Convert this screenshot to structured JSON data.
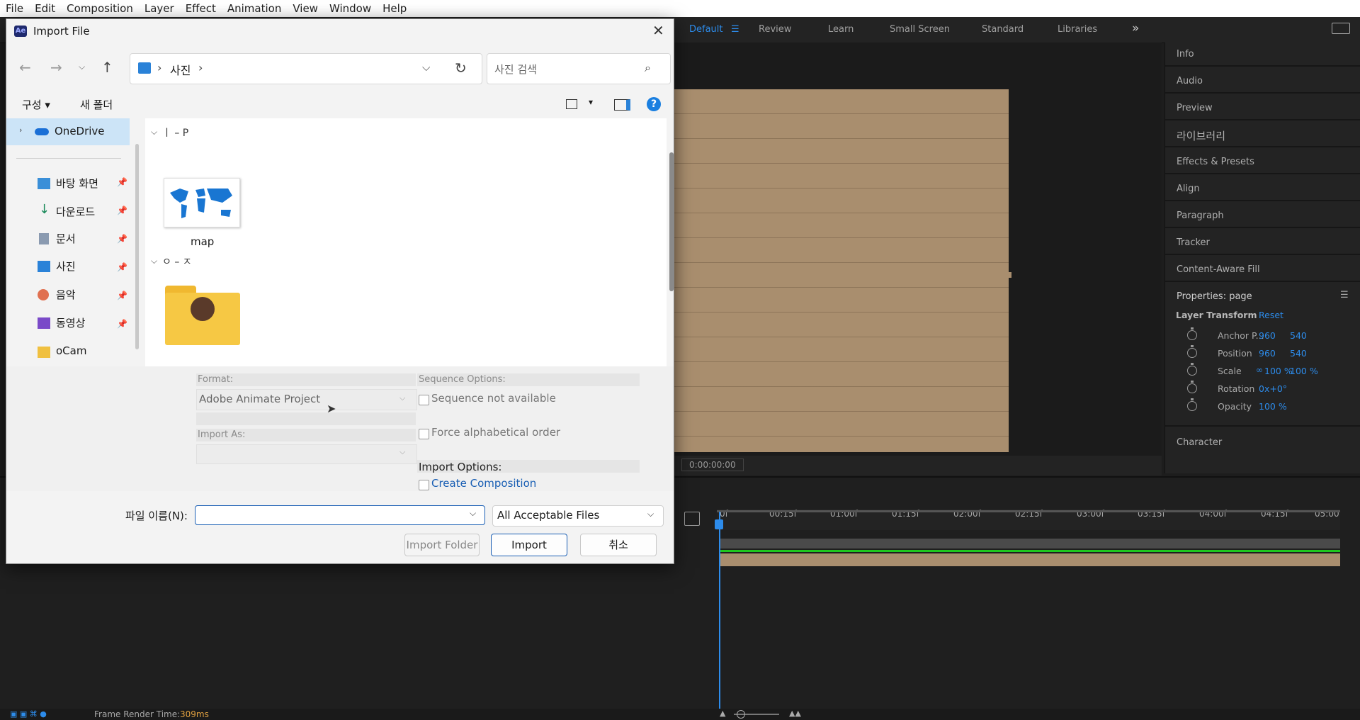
{
  "menubar": [
    "File",
    "Edit",
    "Composition",
    "Layer",
    "Effect",
    "Animation",
    "View",
    "Window",
    "Help"
  ],
  "workspaces": {
    "default": "Default",
    "review": "Review",
    "learn": "Learn",
    "small_screen": "Small Screen",
    "standard": "Standard",
    "libraries": "Libraries",
    "more": "»"
  },
  "right_panel": {
    "items": [
      "Info",
      "Audio",
      "Preview",
      "라이브러리",
      "Effects & Presets",
      "Align",
      "Paragraph",
      "Tracker",
      "Content-Aware Fill"
    ],
    "properties_title": "Properties: page",
    "layer_transform": "Layer Transform",
    "reset": "Reset",
    "props": [
      {
        "label": "Anchor P...",
        "v1": "960",
        "v2": "540"
      },
      {
        "label": "Position",
        "v1": "960",
        "v2": "540"
      },
      {
        "label": "Scale",
        "v1": "100 %",
        "v2": "100 %"
      },
      {
        "label": "Rotation",
        "v1": "0x+0°",
        "v2": ""
      },
      {
        "label": "Opacity",
        "v1": "100 %",
        "v2": ""
      }
    ],
    "character": "Character"
  },
  "viewer": {
    "timecode": "0:00:00:00"
  },
  "timeline": {
    "ticks": [
      "0f",
      "00:15f",
      "01:00f",
      "01:15f",
      "02:00f",
      "02:15f",
      "03:00f",
      "03:15f",
      "04:00f",
      "04:15f",
      "05:00"
    ]
  },
  "status": {
    "render_label": "Frame Render Time:",
    "render_value": "309ms"
  },
  "dialog": {
    "title": "Import File",
    "app_badge": "Ae",
    "breadcrumb_sep": "›",
    "location": "사진",
    "search_placeholder": "사진 검색",
    "toolbar": {
      "organize": "구성 ▾",
      "new_folder": "새 폴더"
    },
    "nav": {
      "onedrive": "OneDrive",
      "items": [
        "바탕 화면",
        "다운로드",
        "문서",
        "사진",
        "음악",
        "동영상",
        "oCam"
      ]
    },
    "groups": [
      {
        "header": "ㅣ – P",
        "files": [
          {
            "name": "map"
          }
        ]
      },
      {
        "header": "ㅇ – ㅈ",
        "files": [
          {
            "name": ""
          }
        ]
      }
    ],
    "format_label": "Format:",
    "format_value": "Adobe Animate Project",
    "import_as_label": "Import As:",
    "sequence_label": "Sequence Options:",
    "sequence_not_available": "Sequence not available",
    "force_alpha": "Force alphabetical order",
    "import_options_label": "Import Options:",
    "create_composition": "Create Composition",
    "filename_label": "파일 이름(N):",
    "filetype": "All Acceptable Files",
    "import_folder": "Import Folder",
    "import": "Import",
    "cancel": "취소"
  },
  "colors": {
    "accent": "#2d8ceb",
    "paper": "#a98e6e",
    "green": "#1ec71e"
  }
}
